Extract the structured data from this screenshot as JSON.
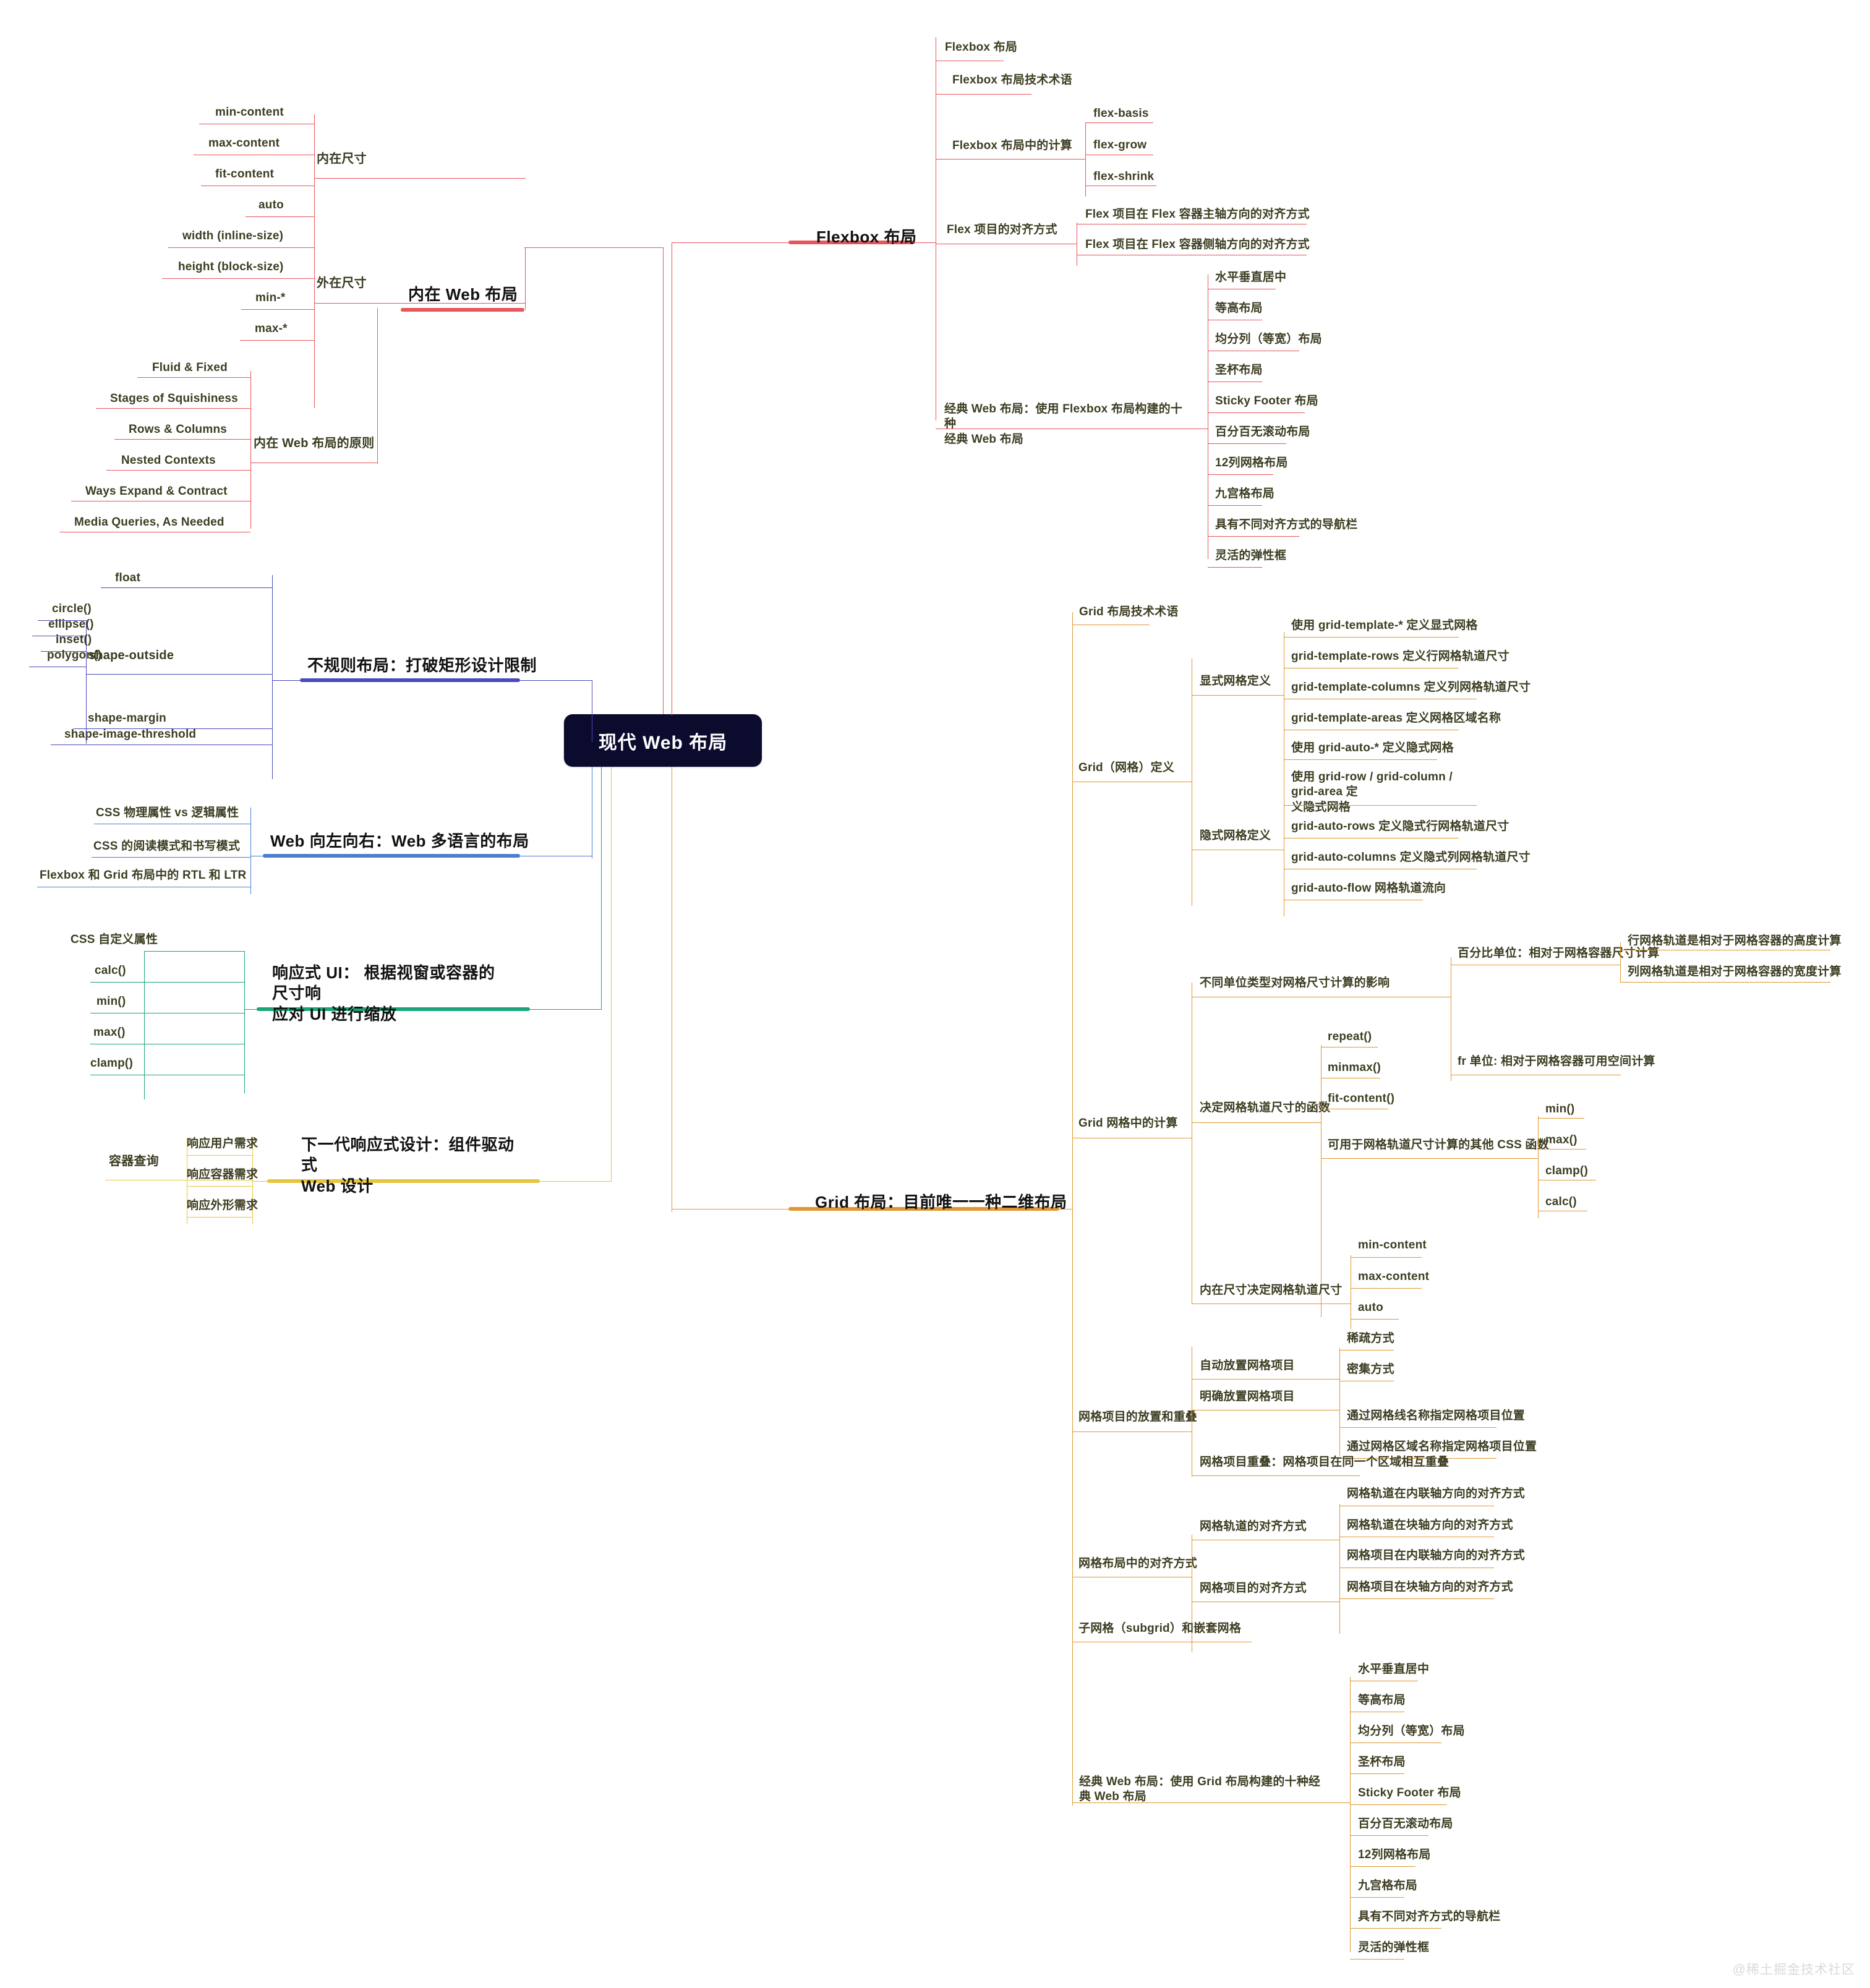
{
  "root": {
    "label": "现代 Web 布局"
  },
  "watermark": "@稀土掘金技术社区",
  "colors": {
    "red": "#e8555a",
    "purple": "#4a4ab8",
    "blue": "#4a7fd0",
    "green": "#18a579",
    "yellow": "#e8c53a",
    "orange": "#e0972f",
    "root_bg": "#0b0b2e",
    "text": "#3a3a1f",
    "branch_text": "#111111"
  },
  "branches": {
    "intrinsic": {
      "label": "内在 Web 布局",
      "color": "#e8555a",
      "groups": {
        "intrinsic_size": {
          "label": "内在尺寸",
          "items": [
            "min-content",
            "max-content",
            "fit-content",
            "auto"
          ]
        },
        "extrinsic_size": {
          "label": "外在尺寸",
          "items": [
            "width (inline-size)",
            "height (block-size)",
            "min-*",
            "max-*"
          ]
        },
        "principles": {
          "label": "内在 Web 布局的原则",
          "items": [
            "Fluid & Fixed",
            "Stages of Squishiness",
            "Rows & Columns",
            "Nested Contexts",
            "Ways Expand & Contract",
            "Media Queries, As Needed"
          ]
        }
      }
    },
    "irregular": {
      "label": "不规则布局：打破矩形设计限制",
      "color": "#4a4ab8",
      "items": [
        "float",
        "shape-outside",
        "shape-margin",
        "shape-image-threshold"
      ],
      "shape_outside_children": [
        "circle()",
        "ellipse()",
        "inset()",
        "polygon()"
      ]
    },
    "direction": {
      "label": "Web 向左向右：Web 多语言的布局",
      "color": "#4a7fd0",
      "items": [
        "CSS 物理属性 vs 逻辑属性",
        "CSS 的阅读模式和书写模式",
        "Flexbox 和 Grid 布局中的 RTL 和 LTR"
      ]
    },
    "responsive_ui": {
      "label": "响应式 UI： 根据视窗或容器的尺寸响\n应对 UI 进行缩放",
      "color": "#18a579",
      "items": [
        "CSS 自定义属性",
        "calc()",
        "min()",
        "max()",
        "clamp()"
      ]
    },
    "next_gen": {
      "label": "下一代响应式设计：组件驱动式\nWeb 设计",
      "color": "#e8c53a",
      "group_label": "容器查询",
      "items": [
        "响应用户需求",
        "响应容器需求",
        "响应外形需求"
      ]
    },
    "flexbox": {
      "label": "Flexbox 布局",
      "color": "#e8555a",
      "items": [
        {
          "label": "Flexbox 布局"
        },
        {
          "label": "Flexbox 布局技术术语"
        },
        {
          "label": "Flexbox 布局中的计算",
          "children": [
            "flex-basis",
            "flex-grow",
            "flex-shrink"
          ]
        },
        {
          "label": "Flex 项目的对齐方式",
          "children": [
            "Flex 项目在 Flex 容器主轴方向的对齐方式",
            "Flex 项目在 Flex 容器侧轴方向的对齐方式"
          ]
        },
        {
          "label": "经典 Web 布局：使用 Flexbox 布局构建的十种\n经典 Web 布局",
          "children": [
            "水平垂直居中",
            "等高布局",
            "均分列（等宽）布局",
            "圣杯布局",
            "Sticky Footer 布局",
            "百分百无滚动布局",
            "12列网格布局",
            "九宫格布局",
            "具有不同对齐方式的导航栏",
            "灵活的弹性框"
          ]
        }
      ]
    },
    "grid": {
      "label": "Grid 布局：目前唯一一种二维布局",
      "color": "#e0972f",
      "terminology": "Grid 布局技术术语",
      "definition": {
        "label": "Grid（网格）定义",
        "explicit": {
          "label": "显式网格定义",
          "items": [
            "使用 grid-template-* 定义显式网格",
            "grid-template-rows 定义行网格轨道尺寸",
            "grid-template-columns 定义列网格轨道尺寸",
            "grid-template-areas 定义网格区域名称"
          ]
        },
        "implicit": {
          "label": "隐式网格定义",
          "items": [
            "使用 grid-auto-* 定义隐式网格",
            "使用 grid-row / grid-column / grid-area 定\n义隐式网格",
            "grid-auto-rows 定义隐式行网格轨道尺寸",
            "grid-auto-columns 定义隐式列网格轨道尺寸",
            "grid-auto-flow 网格轨道流向"
          ]
        }
      },
      "calculation": {
        "label": "Grid 网格中的计算",
        "units": {
          "label": "不同单位类型对网格尺寸计算的影响",
          "percent": {
            "label": "百分比单位：相对于网格容器尺寸计算",
            "children": [
              "行网格轨道是相对于网格容器的高度计算",
              "列网格轨道是相对于网格容器的宽度计算"
            ]
          },
          "fr": {
            "label": "fr 单位: 相对于网格容器可用空间计算"
          }
        },
        "track_functions": {
          "label": "决定网格轨道尺寸的函数",
          "items": [
            "repeat()",
            "minmax()",
            "fit-content()"
          ],
          "other": {
            "label": "可用于网格轨道尺寸计算的其他 CSS 函数",
            "children": [
              "min()",
              "max()",
              "clamp()",
              "calc()"
            ]
          }
        },
        "intrinsic": {
          "label": "内在尺寸决定网格轨道尺寸",
          "children": [
            "min-content",
            "max-content",
            "auto"
          ]
        }
      },
      "placement": {
        "label": "网格项目的放置和重叠",
        "auto": {
          "label": "自动放置网格项目",
          "children": [
            "稀疏方式",
            "密集方式"
          ]
        },
        "explicit": {
          "label": "明确放置网格项目",
          "children": [
            "通过网格线名称指定网格项目位置",
            "通过网格区域名称指定网格项目位置"
          ]
        },
        "overlap": "网格项目重叠：网格项目在同一个区域相互重叠"
      },
      "alignment": {
        "label": "网格布局中的对齐方式",
        "track": {
          "label": "网格轨道的对齐方式",
          "children": [
            "网格轨道在内联轴方向的对齐方式",
            "网格轨道在块轴方向的对齐方式"
          ]
        },
        "item": {
          "label": "网格项目的对齐方式",
          "children": [
            "网格项目在内联轴方向的对齐方式",
            "网格项目在块轴方向的对齐方式"
          ]
        }
      },
      "subgrid": "子网格（subgrid）和嵌套网格",
      "classic": {
        "label": "经典 Web 布局：使用 Grid 布局构建的十种经\n典 Web 布局",
        "items": [
          "水平垂直居中",
          "等高布局",
          "均分列（等宽）布局",
          "圣杯布局",
          "Sticky Footer 布局",
          "百分百无滚动布局",
          "12列网格布局",
          "九宫格布局",
          "具有不同对齐方式的导航栏",
          "灵活的弹性框"
        ]
      }
    }
  }
}
